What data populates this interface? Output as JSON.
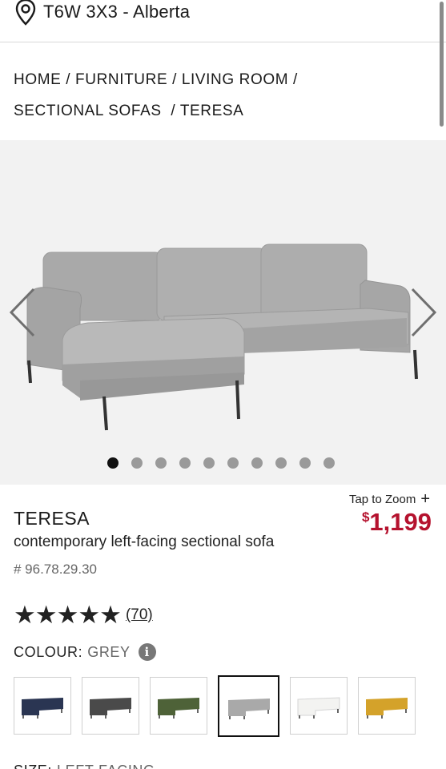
{
  "location": {
    "text": "T6W 3X3 - Alberta",
    "icon": "location-pin-icon"
  },
  "breadcrumb": [
    {
      "label": "HOME"
    },
    {
      "label": "FURNITURE"
    },
    {
      "label": "LIVING ROOM"
    },
    {
      "label": "SECTIONAL SOFAS"
    },
    {
      "label": "TERESA"
    }
  ],
  "gallery": {
    "prev_icon": "chevron-left-icon",
    "next_icon": "chevron-right-icon",
    "image_count": 10,
    "active_index": 0
  },
  "product": {
    "zoom_label": "Tap to Zoom",
    "zoom_symbol": "+",
    "name": "TERESA",
    "subtitle": "contemporary left-facing sectional sofa",
    "sku": "# 96.78.29.30",
    "price_symbol": "$",
    "price_value": "1,199",
    "price_color": "#b5122e",
    "rating_stars": 5,
    "rating_count": "(70)"
  },
  "colour": {
    "label": "COLOUR:",
    "value": "GREY",
    "info_icon": "info-icon",
    "options": [
      {
        "name": "navy",
        "hex": "#2a3552",
        "selected": false
      },
      {
        "name": "charcoal",
        "hex": "#4a4a4a",
        "selected": false
      },
      {
        "name": "green",
        "hex": "#4e6238",
        "selected": false
      },
      {
        "name": "grey",
        "hex": "#a9a9a9",
        "selected": true
      },
      {
        "name": "white",
        "hex": "#f3f3f1",
        "selected": false
      },
      {
        "name": "yellow",
        "hex": "#d4a22a",
        "selected": false
      }
    ]
  },
  "size": {
    "label": "SIZE:",
    "value": "LEFT-FACING"
  }
}
